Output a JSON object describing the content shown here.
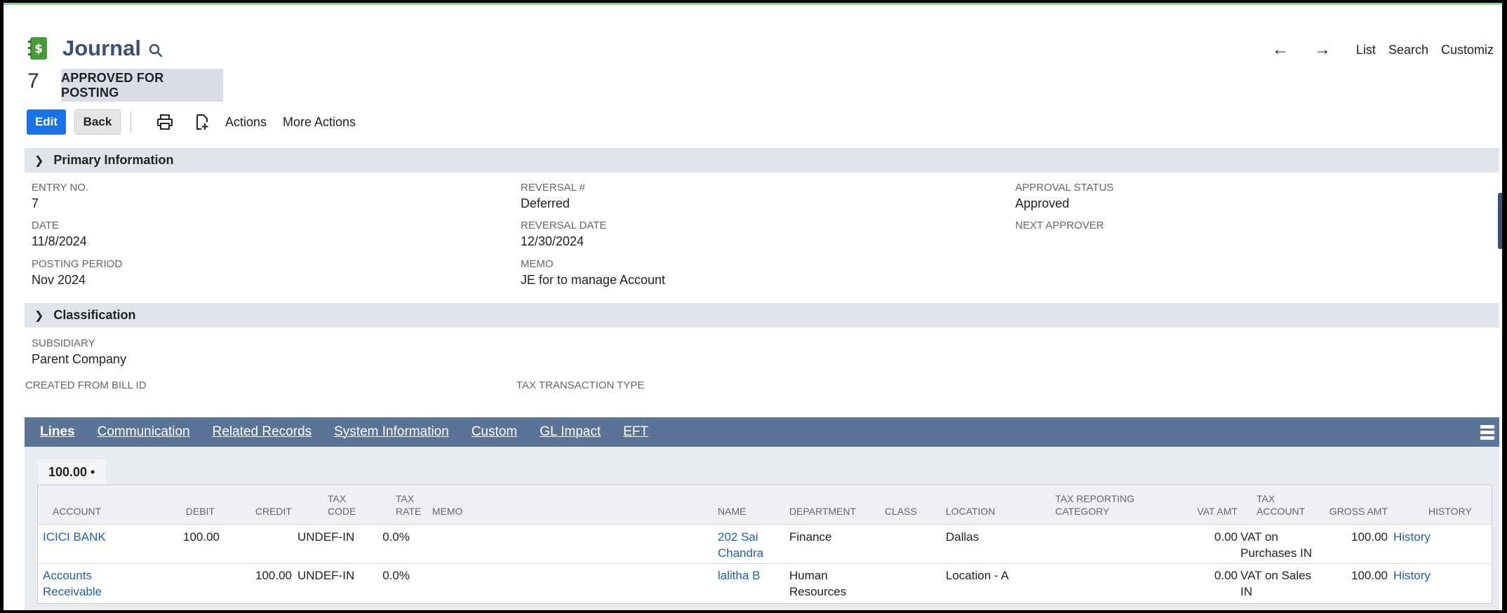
{
  "header": {
    "title": "Journal",
    "record_number": "7",
    "status": "APPROVED FOR POSTING",
    "nav": {
      "list": "List",
      "search": "Search",
      "customize": "Customiz"
    }
  },
  "toolbar": {
    "edit_label": "Edit",
    "back_label": "Back",
    "actions_label": "Actions",
    "more_actions_label": "More Actions"
  },
  "primary": {
    "section_title": "Primary Information",
    "entry_no_label": "ENTRY NO.",
    "entry_no": "7",
    "date_label": "DATE",
    "date": "11/8/2024",
    "posting_period_label": "POSTING PERIOD",
    "posting_period": "Nov 2024",
    "reversal_no_label": "REVERSAL #",
    "reversal_no": "Deferred",
    "reversal_date_label": "REVERSAL DATE",
    "reversal_date": "12/30/2024",
    "memo_label": "MEMO",
    "memo": "JE for to manage Account",
    "approval_status_label": "APPROVAL STATUS",
    "approval_status": "Approved",
    "next_approver_label": "NEXT APPROVER"
  },
  "classification": {
    "section_title": "Classification",
    "subsidiary_label": "SUBSIDIARY",
    "subsidiary": "Parent Company",
    "created_from_label": "CREATED FROM BILL ID",
    "tax_transaction_type_label": "TAX TRANSACTION TYPE"
  },
  "tabs": [
    "Lines",
    "Communication",
    "Related Records",
    "System Information",
    "Custom",
    "GL Impact",
    "EFT"
  ],
  "lines": {
    "subtab_label": "100.00 •",
    "columns": {
      "account": "ACCOUNT",
      "debit": "DEBIT",
      "credit": "CREDIT",
      "tax_code_1": "TAX",
      "tax_code_2": "CODE",
      "tax_rate_1": "TAX",
      "tax_rate_2": "RATE",
      "memo": "MEMO",
      "name": "NAME",
      "department": "DEPARTMENT",
      "class": "CLASS",
      "location": "LOCATION",
      "tax_reporting_1": "TAX REPORTING",
      "tax_reporting_2": "CATEGORY",
      "vat_amt": "VAT AMT",
      "tax_account_1": "TAX",
      "tax_account_2": "ACCOUNT",
      "gross_amt": "GROSS AMT",
      "history": "HISTORY"
    },
    "rows": [
      {
        "account": "ICICI BANK",
        "account2": "",
        "debit": "100.00",
        "credit": "",
        "tax_code": "UNDEF-IN",
        "tax_rate": "0.0%",
        "name": "202 Sai",
        "name2": "Chandra",
        "department": "Finance",
        "department2": "",
        "location": "Dallas",
        "vat_amt": "0.00",
        "tax_account": "VAT on",
        "tax_account2": "Purchases IN",
        "gross_amt": "100.00",
        "history": "History"
      },
      {
        "account": "Accounts",
        "account2": "Receivable",
        "debit": "",
        "credit": "100.00",
        "tax_code": "UNDEF-IN",
        "tax_rate": "0.0%",
        "name": "lalitha B",
        "name2": "",
        "department": "Human",
        "department2": "Resources",
        "location": "Location - A",
        "vat_amt": "0.00",
        "tax_account": "VAT on Sales",
        "tax_account2": "IN",
        "gross_amt": "100.00",
        "history": "History"
      }
    ]
  },
  "colors": {
    "accent": "#1a73e8",
    "tab_bar": "#5a7497",
    "section_bar": "#e1e4eb",
    "link": "#1f5eb4",
    "title": "#3a4f7a",
    "icon_green": "#4a9a3a"
  }
}
